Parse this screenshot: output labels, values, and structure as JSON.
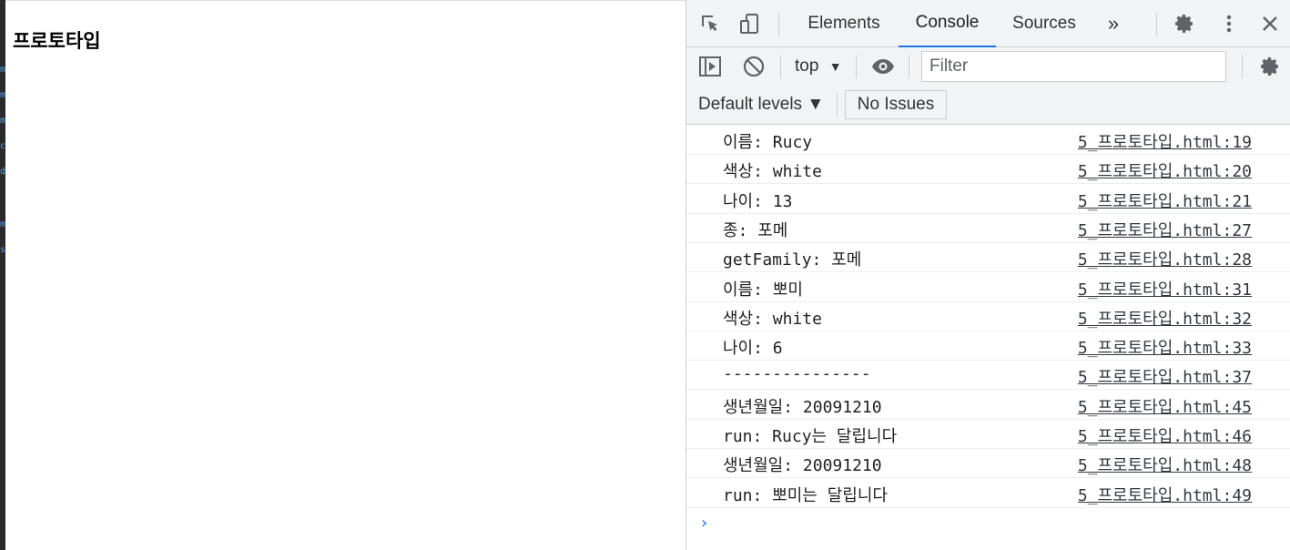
{
  "page": {
    "heading": "프로토타입"
  },
  "devtools": {
    "tabs": [
      "Elements",
      "Console",
      "Sources"
    ],
    "active_tab": "Console",
    "more_tabs_glyph": "»",
    "context": "top",
    "filter_placeholder": "Filter",
    "levels": "Default levels ▼",
    "issues": "No Issues",
    "accent_color": "#1a73e8"
  },
  "console": {
    "messages": [
      {
        "text": "이름: Rucy",
        "source": "5_프로토타입.html:19"
      },
      {
        "text": "색상: white",
        "source": "5_프로토타입.html:20"
      },
      {
        "text": "나이: 13",
        "source": "5_프로토타입.html:21"
      },
      {
        "text": "종: 포메",
        "source": "5_프로토타입.html:27"
      },
      {
        "text": "getFamily: 포메",
        "source": "5_프로토타입.html:28"
      },
      {
        "text": "이름: 뽀미",
        "source": "5_프로토타입.html:31"
      },
      {
        "text": "색상: white",
        "source": "5_프로토타입.html:32"
      },
      {
        "text": "나이: 6",
        "source": "5_프로토타입.html:33"
      },
      {
        "text": "---------------",
        "source": "5_프로토타입.html:37"
      },
      {
        "text": "생년월일: 20091210",
        "source": "5_프로토타입.html:45"
      },
      {
        "text": "run: Rucy는 달립니다",
        "source": "5_프로토타입.html:46"
      },
      {
        "text": "생년월일: 20091210",
        "source": "5_프로토타입.html:48"
      },
      {
        "text": "run: 뽀미는 달립니다",
        "source": "5_프로토타입.html:49"
      }
    ],
    "prompt_glyph": "›"
  }
}
